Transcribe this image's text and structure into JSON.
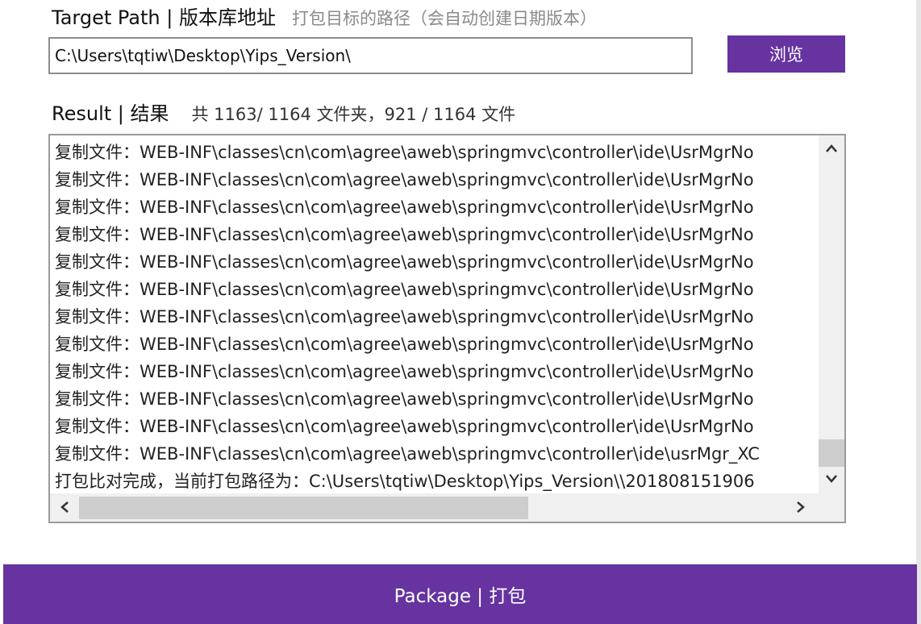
{
  "target": {
    "title": "Target Path | 版本库地址",
    "hint": "打包目标的路径（会自动创建日期版本）",
    "path_value": "C:\\Users\\tqtiw\\Desktop\\Yips_Version\\",
    "browse_label": "浏览"
  },
  "result": {
    "title": "Result | 结果",
    "summary": "共 1163/ 1164 文件夹，921 / 1164 文件",
    "log_lines": [
      "复制文件：WEB-INF\\classes\\cn\\com\\agree\\aweb\\springmvc\\controller\\ide\\UsrMgrNo",
      "复制文件：WEB-INF\\classes\\cn\\com\\agree\\aweb\\springmvc\\controller\\ide\\UsrMgrNo",
      "复制文件：WEB-INF\\classes\\cn\\com\\agree\\aweb\\springmvc\\controller\\ide\\UsrMgrNo",
      "复制文件：WEB-INF\\classes\\cn\\com\\agree\\aweb\\springmvc\\controller\\ide\\UsrMgrNo",
      "复制文件：WEB-INF\\classes\\cn\\com\\agree\\aweb\\springmvc\\controller\\ide\\UsrMgrNo",
      "复制文件：WEB-INF\\classes\\cn\\com\\agree\\aweb\\springmvc\\controller\\ide\\UsrMgrNo",
      "复制文件：WEB-INF\\classes\\cn\\com\\agree\\aweb\\springmvc\\controller\\ide\\UsrMgrNo",
      "复制文件：WEB-INF\\classes\\cn\\com\\agree\\aweb\\springmvc\\controller\\ide\\UsrMgrNo",
      "复制文件：WEB-INF\\classes\\cn\\com\\agree\\aweb\\springmvc\\controller\\ide\\UsrMgrNo",
      "复制文件：WEB-INF\\classes\\cn\\com\\agree\\aweb\\springmvc\\controller\\ide\\UsrMgrNo",
      "复制文件：WEB-INF\\classes\\cn\\com\\agree\\aweb\\springmvc\\controller\\ide\\UsrMgrNo",
      "复制文件：WEB-INF\\classes\\cn\\com\\agree\\aweb\\springmvc\\controller\\ide\\usrMgr_XC",
      "打包比对完成，当前打包路径为：C:\\Users\\tqtiw\\Desktop\\Yips_Version\\\\201808151906"
    ]
  },
  "package_label": "Package | 打包",
  "icons": {
    "scroll_up": "chevron-up-icon",
    "scroll_down": "chevron-down-icon",
    "scroll_left": "chevron-left-icon",
    "scroll_right": "chevron-right-icon"
  },
  "colors": {
    "accent": "#6633a0",
    "hint_text": "#8a8a8a"
  }
}
